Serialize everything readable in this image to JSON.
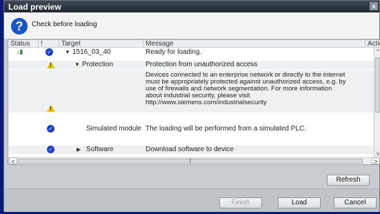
{
  "window": {
    "title": "Load preview",
    "close_glyph": "x"
  },
  "header": {
    "icon": "question-icon",
    "icon_glyph": "?",
    "heading": "Check before loading"
  },
  "columns": [
    "Status",
    "!",
    "Target",
    "Message",
    "Actio"
  ],
  "rows": [
    {
      "status": "↓▮",
      "target": "1516_03_40",
      "message": "Ready for loading."
    },
    {
      "target": "Protection",
      "message": "Protection from unauthorized access"
    },
    {
      "message": "Devices connected to an enterprise network or directly to the internet\nmust be appropriately protected against unauthorized access, e.g. by\nuse of firewalls and network segmentation. For more information\nabout industrial security, please visit\nhttp://www.siemens.com/industrialsecurity"
    },
    {
      "target": "Simulated module",
      "message": "The loading will be performed from a simulated PLC."
    },
    {
      "target": "Software",
      "message": "Download software to device"
    }
  ],
  "buttons": {
    "refresh": "Refresh",
    "finish": "Finish",
    "load": "Load",
    "cancel": "Cancel"
  },
  "colors": {
    "accent": "#1a3fd0",
    "warning": "#e6c400",
    "background": "#0a1a7a"
  }
}
